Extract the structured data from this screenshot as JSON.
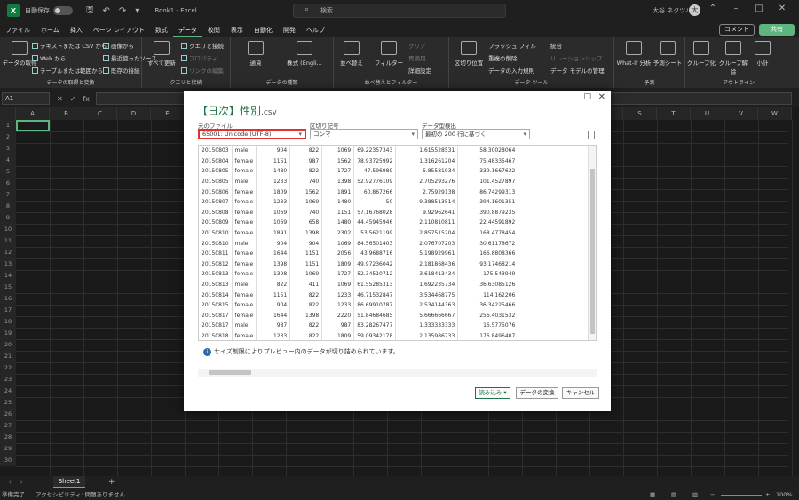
{
  "titlebar": {
    "autosave_label": "自動保存",
    "autosave_state": "オフ",
    "doc_title": "Book1 - Excel",
    "search_placeholder": "検索",
    "user_name": "大谷 ネクツハイ",
    "user_initial": "大"
  },
  "tabs": [
    "ファイル",
    "ホーム",
    "挿入",
    "ページ レイアウト",
    "数式",
    "データ",
    "校閲",
    "表示",
    "自動化",
    "開発",
    "ヘルプ"
  ],
  "active_tab": "データ",
  "comment_button": "コメント",
  "share_button": "共有",
  "ribbon": {
    "get_data": "データの取得",
    "from_text_csv": "テキストまたは CSV から",
    "from_web": "Web から",
    "from_table": "テーブルまたは範囲から",
    "from_picture": "画像から",
    "recent_sources": "最近使ったソース",
    "existing_connections": "既存の接続",
    "group_get_transform": "データの取得と変換",
    "refresh_all": "すべて更新",
    "queries_connections": "クエリと接続",
    "properties": "プロパティ",
    "edit_links": "リンクの編集",
    "group_queries": "クエリと接続",
    "stocks": "株式 (Engli...",
    "currencies": "通貨",
    "group_data_types": "データの種類",
    "sort": "並べ替え",
    "filter": "フィルター",
    "clear": "クリア",
    "reapply": "再適用",
    "advanced": "詳細設定",
    "group_sort_filter": "並べ替えとフィルター",
    "text_to_columns": "区切り位置",
    "flash_fill": "フラッシュ フィル",
    "remove_duplicates": "重複の削除",
    "data_validation": "データの入力規則",
    "consolidate": "統合",
    "relationships": "リレーションシップ",
    "data_model": "データ モデルの管理",
    "group_data_tools": "データ ツール",
    "what_if": "What-If 分析",
    "forecast_sheet": "予測シート",
    "group_forecast": "予測",
    "group": "グループ化",
    "ungroup": "グループ解除",
    "subtotal": "小計",
    "group_outline": "アウトライン"
  },
  "formula_bar": {
    "name_box": "A1",
    "fx": "fx"
  },
  "columns": [
    "A",
    "B",
    "C",
    "D",
    "E",
    "F",
    "G",
    "H",
    "I",
    "J",
    "K",
    "L",
    "M",
    "N",
    "O",
    "P",
    "Q",
    "R",
    "S",
    "T",
    "U",
    "V",
    "W"
  ],
  "rows": [
    "1",
    "2",
    "3",
    "4",
    "5",
    "6",
    "7",
    "8",
    "9",
    "10",
    "11",
    "12",
    "13",
    "14",
    "15",
    "16",
    "17",
    "18",
    "19",
    "20",
    "21",
    "22",
    "23",
    "24",
    "25",
    "26",
    "27",
    "28",
    "29",
    "30"
  ],
  "sheet_tab": "Sheet1",
  "status": {
    "ready": "準備完了",
    "accessibility": "アクセシビリティ: 問題ありません",
    "zoom": "100%"
  },
  "dialog": {
    "title_main": "【日次】性別",
    "title_ext": ".csv",
    "file_origin_label": "元のファイル",
    "file_origin_value": "65001: Unicode (UTF-8)",
    "delimiter_label": "区切り記号",
    "delimiter_value": "コンマ",
    "detect_label": "データ型検出",
    "detect_value": "最初の 200 行に基づく",
    "info_text": "サイズ制限によりプレビュー内のデータが切り詰められています。",
    "load_button": "読み込み",
    "transform_button": "データの変換",
    "cancel_button": "キャンセル"
  },
  "preview_rows": [
    [
      "20150803",
      "male",
      "904",
      "822",
      "1069",
      "69.22357343",
      "1.615528531",
      "58.30028064"
    ],
    [
      "20150804",
      "female",
      "1151",
      "987",
      "1562",
      "78.93725992",
      "1.316261204",
      "75.48335467"
    ],
    [
      "20150805",
      "female",
      "1480",
      "822",
      "1727",
      "47.596989",
      "5.85581934",
      "339.1667632"
    ],
    [
      "20150805",
      "male",
      "1233",
      "740",
      "1398",
      "52.92776109",
      "2.705293276",
      "101.4527897"
    ],
    [
      "20150806",
      "female",
      "1809",
      "1562",
      "1891",
      "60.867266",
      "2.75929138",
      "86.74299313"
    ],
    [
      "20150807",
      "female",
      "1233",
      "1069",
      "1480",
      "50",
      "9.388513514",
      "394.1601351"
    ],
    [
      "20150808",
      "female",
      "1069",
      "740",
      "1151",
      "57.16768028",
      "9.92962641",
      "390.8879235"
    ],
    [
      "20150809",
      "female",
      "1069",
      "658",
      "1480",
      "44.45945946",
      "2.110810811",
      "22.44591892"
    ],
    [
      "20150810",
      "female",
      "1891",
      "1398",
      "2302",
      "53.5621199",
      "2.857515204",
      "168.4778454"
    ],
    [
      "20150810",
      "male",
      "904",
      "904",
      "1069",
      "84.56501403",
      "2.076707203",
      "30.61178672"
    ],
    [
      "20150811",
      "female",
      "1644",
      "1151",
      "2056",
      "43.9688716",
      "5.198929961",
      "166.8808366"
    ],
    [
      "20150812",
      "female",
      "1398",
      "1151",
      "1809",
      "49.97236042",
      "2.181868436",
      "93.17468214"
    ],
    [
      "20150813",
      "female",
      "1398",
      "1069",
      "1727",
      "52.34510712",
      "3.618413434",
      "175.543949"
    ],
    [
      "20150813",
      "male",
      "822",
      "411",
      "1069",
      "61.55285313",
      "1.692235734",
      "36.63085126"
    ],
    [
      "20150814",
      "female",
      "1151",
      "822",
      "1233",
      "46.71532847",
      "3.534468775",
      "114.162206"
    ],
    [
      "20150815",
      "female",
      "904",
      "822",
      "1233",
      "86.69910787",
      "2.534144363",
      "36.34225466"
    ],
    [
      "20150817",
      "female",
      "1644",
      "1398",
      "2220",
      "51.84684685",
      "5.666666667",
      "256.4031532"
    ],
    [
      "20150817",
      "male",
      "987",
      "822",
      "987",
      "83.28267477",
      "1.333333333",
      "16.5775076"
    ],
    [
      "20150818",
      "female",
      "1233",
      "822",
      "1809",
      "59.09342178",
      "2.135986733",
      "176.8496407"
    ]
  ]
}
